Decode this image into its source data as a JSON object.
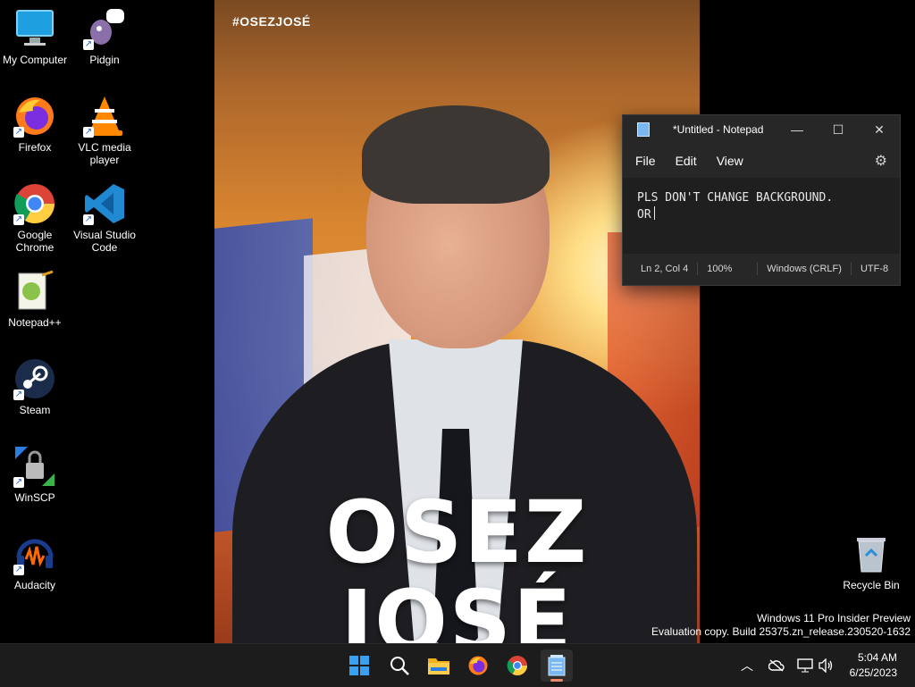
{
  "desktop": {
    "icons": [
      {
        "label": "My Computer",
        "icon": "my-computer-icon"
      },
      {
        "label": "Pidgin",
        "icon": "pidgin-icon"
      },
      {
        "label": "Firefox",
        "icon": "firefox-icon"
      },
      {
        "label": "VLC media player",
        "icon": "vlc-icon"
      },
      {
        "label": "Google Chrome",
        "icon": "chrome-icon"
      },
      {
        "label": "Visual Studio Code",
        "icon": "vscode-icon"
      },
      {
        "label": "Notepad++",
        "icon": "notepad-plus-plus-icon"
      },
      {
        "label": "Steam",
        "icon": "steam-icon"
      },
      {
        "label": "WinSCP",
        "icon": "winscp-icon"
      },
      {
        "label": "Audacity",
        "icon": "audacity-icon"
      },
      {
        "label": "Recycle Bin",
        "icon": "recycle-bin-icon"
      }
    ]
  },
  "wallpaper": {
    "hashtag": "#OSEZJOSÉ",
    "line1": "OSEZ",
    "line2": "JOSÉ"
  },
  "notepad": {
    "title": "*Untitled - Notepad",
    "menu": [
      "File",
      "Edit",
      "View"
    ],
    "content_line1": "PLS DON'T CHANGE BACKGROUND.",
    "content_line2": "OR",
    "status": {
      "position": "Ln 2, Col 4",
      "zoom": "100%",
      "line_ending": "Windows (CRLF)",
      "encoding": "UTF-8"
    }
  },
  "watermark": {
    "line1": "Windows 11 Pro Insider Preview",
    "line2": "Evaluation copy. Build 25375.zn_release.230520-1632"
  },
  "taskbar": {
    "apps": [
      "start-icon",
      "search-icon",
      "file-explorer-icon",
      "firefox-icon",
      "chrome-icon",
      "notepad-icon"
    ],
    "active_app": "notepad-icon"
  },
  "clock": {
    "time": "5:04 AM",
    "date": "6/25/2023"
  },
  "colors": {
    "taskbar_bg": "#1c1c1c",
    "notepad_bg": "#272727",
    "accent_indicator": "#f08a6a"
  }
}
